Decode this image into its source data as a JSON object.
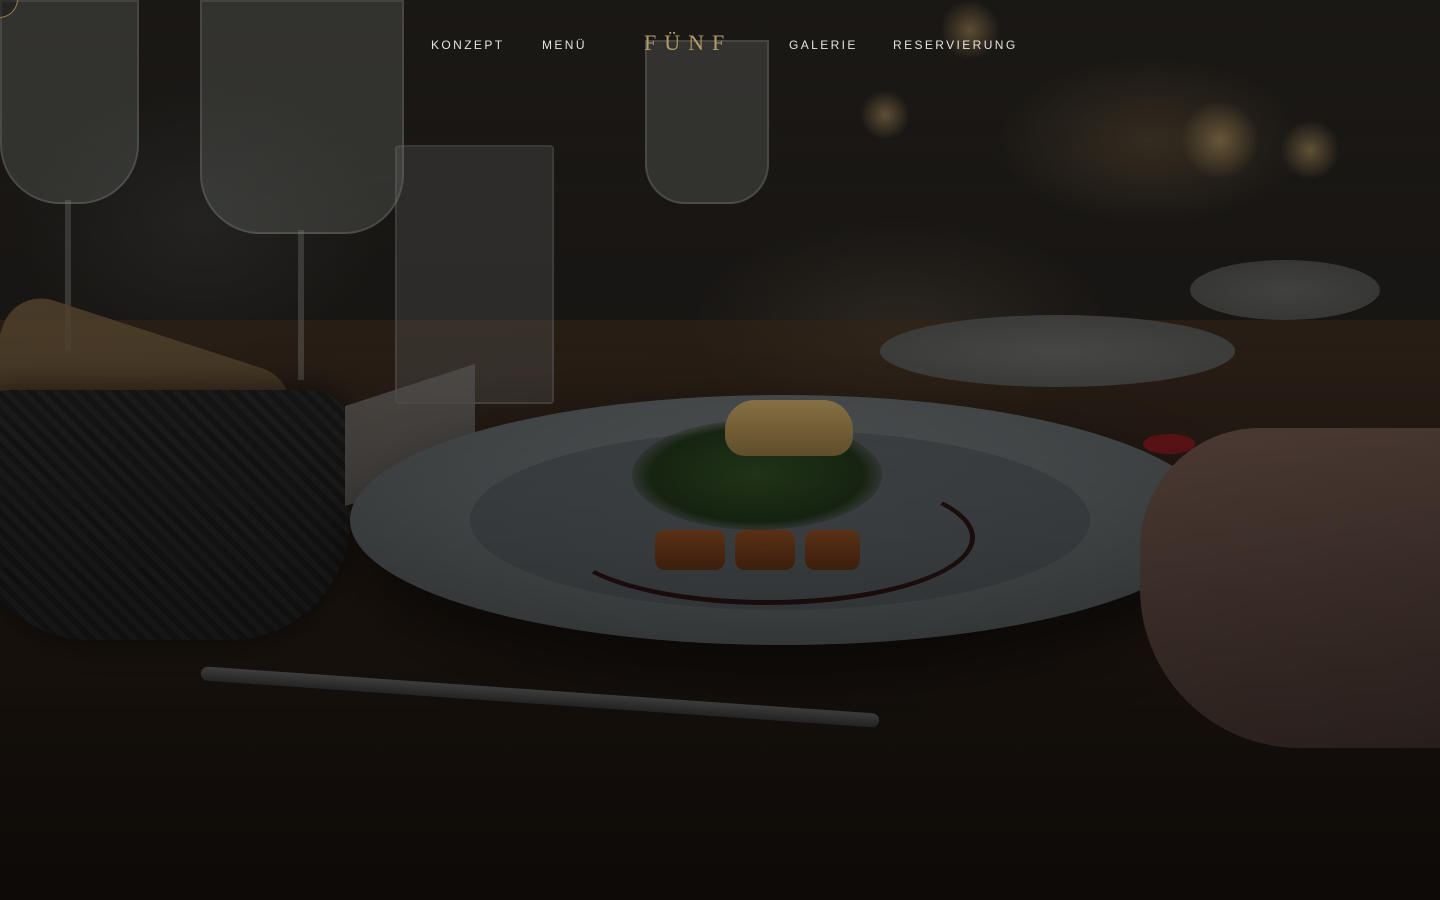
{
  "nav": {
    "links": [
      {
        "label": "KONZEPT"
      },
      {
        "label": "MENÜ"
      },
      {
        "label": "GALERIE"
      },
      {
        "label": "RESERVIERUNG"
      }
    ],
    "logo": "FÜNF"
  },
  "hero": {
    "image": "restaurant-plate-photo"
  },
  "colors": {
    "logo_gold": "#b59a6a",
    "nav_text": "#e6e2dc",
    "overlay": "#000000"
  }
}
